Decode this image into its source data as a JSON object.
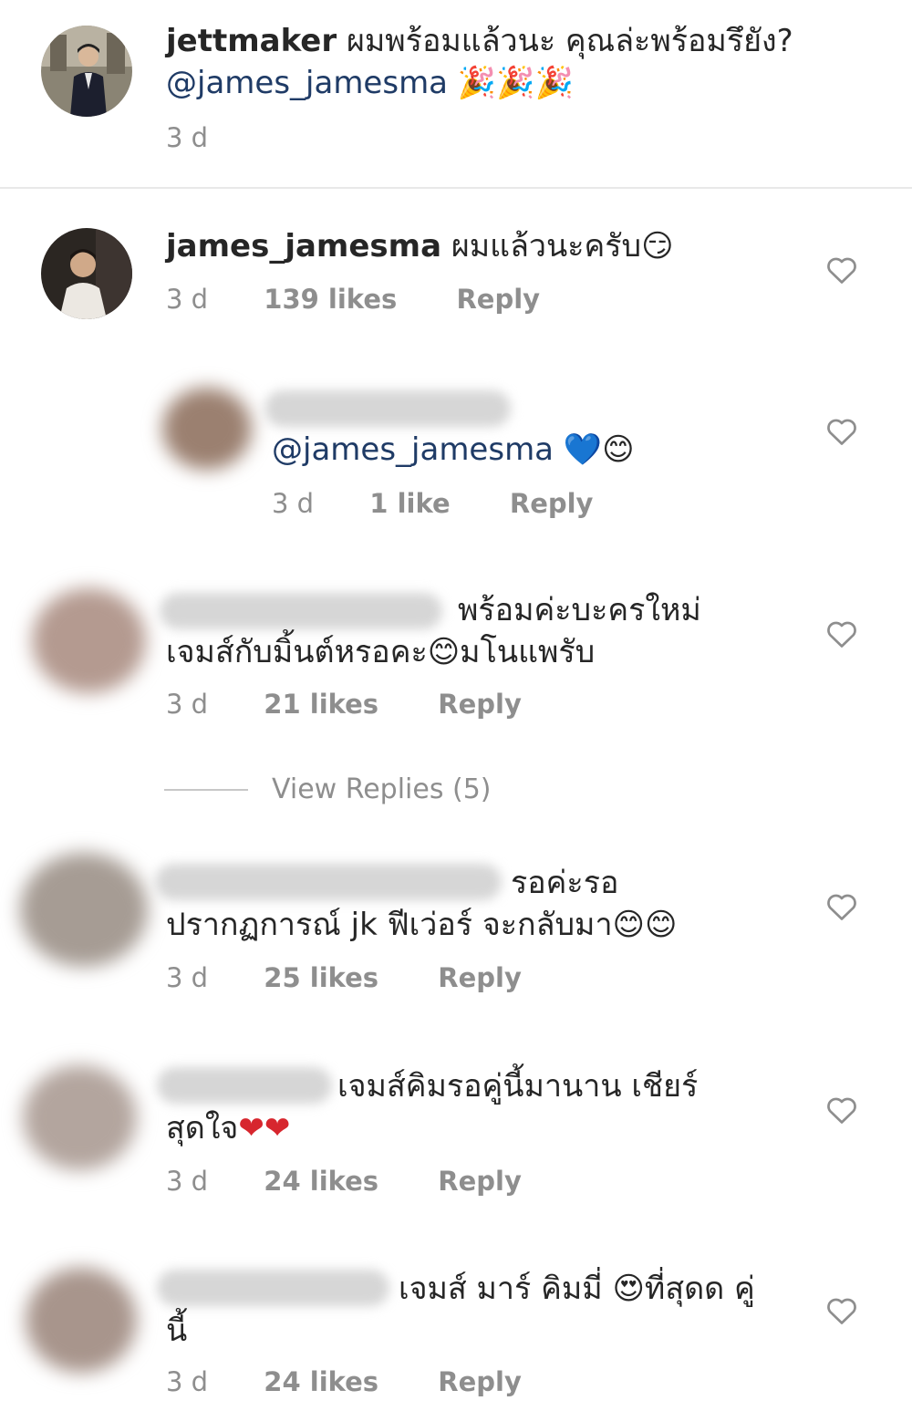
{
  "caption": {
    "username": "jettmaker",
    "text": "ผมพร้อมแล้วนะ คุณล่ะพร้อมรึยัง?",
    "mention": "@james_jamesma",
    "emoji": "🎉🎉🎉",
    "time": "3 d"
  },
  "comments": [
    {
      "username": "james_jamesma",
      "text": "ผมแล้วนะครับ",
      "emoji": "😏",
      "time": "3 d",
      "likes": "139 likes",
      "reply": "Reply"
    },
    {
      "mention": "@james_jamesma",
      "emoji": "💙😊",
      "time": "3 d",
      "likes": "1 like",
      "reply": "Reply"
    },
    {
      "line1": "พร้อมค่ะบะครใหม่",
      "line2": "เจมส์กับมิ้นต์หรอคะ",
      "emoji": "😊",
      "line2_end": "มโนแพรับ",
      "time": "3 d",
      "likes": "21 likes",
      "reply": "Reply"
    },
    {
      "line1": "รอค่ะรอ",
      "line2": "ปรากฏการณ์ jk ฟีเว่อร์ จะกลับมา",
      "emoji": "😊😊",
      "time": "3 d",
      "likes": "25 likes",
      "reply": "Reply"
    },
    {
      "line1": "เจมส์คิมรอคู่นี้มานาน เชียร์",
      "line2": "สุดใจ",
      "emoji": "❤❤",
      "time": "3 d",
      "likes": "24 likes",
      "reply": "Reply"
    },
    {
      "line1_a": "เจมส์ มาร์ คิมมี่",
      "emoji": "😍",
      "line1_b": "ที่สุดด คู่",
      "line2": "นี้",
      "time": "3 d",
      "likes": "24 likes",
      "reply": "Reply"
    }
  ],
  "view_replies": "View Replies (5)"
}
